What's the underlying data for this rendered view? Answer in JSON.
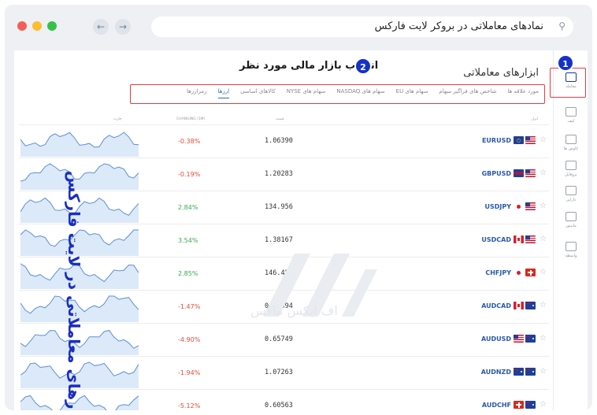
{
  "browser": {
    "url_text": "نمادهای معاملاتی در بروکر لایت فارکس",
    "search_icon": "search-icon",
    "back_icon": "arrow-left-icon",
    "forward_icon": "arrow-right-icon",
    "dot_colors": [
      "#f25f58",
      "#fbbe2e",
      "#38c149"
    ]
  },
  "sidebar": {
    "items": [
      {
        "icon": "chart-icon",
        "label": "معامله",
        "active": true
      },
      {
        "icon": "user-icon",
        "label": "کیف"
      },
      {
        "icon": "search-icon",
        "label": "کاوش ها"
      },
      {
        "icon": "card-icon",
        "label": "پروفایل"
      },
      {
        "icon": "dollar-icon",
        "label": "دارایی"
      },
      {
        "icon": "monitor-icon",
        "label": "مانیتور"
      },
      {
        "icon": "handshake-icon",
        "label": "واسطه"
      }
    ]
  },
  "annotations": {
    "badge1": "1",
    "badge2": "2",
    "title": "انتخاب بازار مالی مورد نظر",
    "vertical_label": "ابزارهای معاملاتی در لایت فارکس",
    "watermark_text": "اف ایکس ماکس"
  },
  "panel": {
    "title": "ابزارهای معاملاتی",
    "tabs": [
      {
        "label": "رمزارزها"
      },
      {
        "label": "ارزها",
        "active": true
      },
      {
        "label": "کالاهای اساسی"
      },
      {
        "label": "سهام های NYSE"
      },
      {
        "label": "سهام های NASDAQ"
      },
      {
        "label": "سهام های EU"
      },
      {
        "label": "شاخص های فراگیر سهام"
      },
      {
        "label": "مورد علاقه ها"
      }
    ],
    "columns": {
      "chart": "چارت",
      "change": "CHANGING (1M)",
      "price": "قیمت",
      "instrument": "ابزار"
    }
  },
  "rows": [
    {
      "symbol": "EURUSD",
      "price": "1.06390",
      "change": "-0.38%",
      "flags": [
        "eu",
        "us"
      ]
    },
    {
      "symbol": "GBPUSD",
      "price": "1.20283",
      "change": "-0.19%",
      "flags": [
        "gb",
        "us"
      ]
    },
    {
      "symbol": "USDJPY",
      "price": "134.956",
      "change": "2.84%",
      "flags": [
        "jp",
        "us"
      ]
    },
    {
      "symbol": "USDCAD",
      "price": "1.38167",
      "change": "3.54%",
      "flags": [
        "ca",
        "us"
      ]
    },
    {
      "symbol": "CHFJPY",
      "price": "146.452",
      "change": "2.85%",
      "flags": [
        "jp",
        "ch"
      ]
    },
    {
      "symbol": "AUDCAD",
      "price": "0.90894",
      "change": "-1.47%",
      "flags": [
        "ca",
        "au"
      ]
    },
    {
      "symbol": "AUDUSD",
      "price": "0.65749",
      "change": "-4.90%",
      "flags": [
        "us",
        "au"
      ]
    },
    {
      "symbol": "AUDNZD",
      "price": "1.07263",
      "change": "-1.94%",
      "flags": [
        "nz",
        "au"
      ]
    },
    {
      "symbol": "AUDCHF",
      "price": "0.60563",
      "change": "-5.12%",
      "flags": [
        "ch",
        "au"
      ]
    }
  ],
  "colors": {
    "positive": "#3aa757",
    "negative": "#e24a3b",
    "accent": "#1432c8",
    "highlight": "#e63946",
    "spark_line": "#5b8fd6",
    "spark_fill": "#dce9f8"
  }
}
